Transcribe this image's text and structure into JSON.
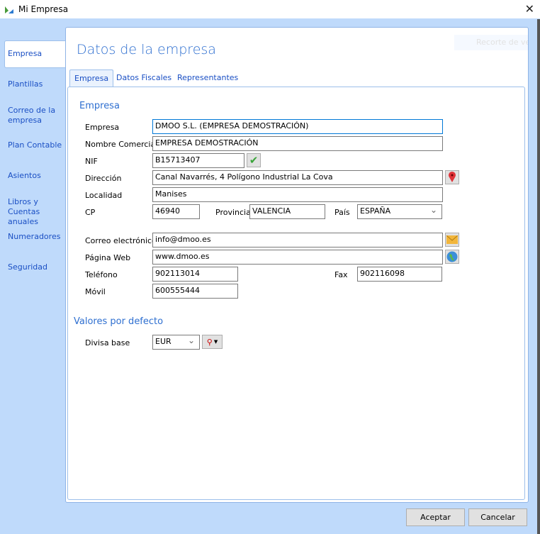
{
  "window": {
    "title": "Mi Empresa"
  },
  "sidebar": {
    "items": [
      {
        "label": "Empresa"
      },
      {
        "label": "Plantillas"
      },
      {
        "label": "Correo de la empresa"
      },
      {
        "label": "Plan Contable"
      },
      {
        "label": "Asientos"
      },
      {
        "label": "Libros y Cuentas anuales"
      },
      {
        "label": "Numeradores"
      },
      {
        "label": "Seguridad"
      }
    ]
  },
  "header": {
    "title": "Datos de la empresa",
    "ghost": "Recorte de ventana"
  },
  "tabs": [
    {
      "label": "Empresa"
    },
    {
      "label": "Datos Fiscales"
    },
    {
      "label": "Representantes"
    }
  ],
  "form": {
    "section": "Empresa",
    "empresa": {
      "label": "Empresa",
      "value": "DMOO S.L. (EMPRESA DEMOSTRACIÓN)"
    },
    "nombre_comercial": {
      "label": "Nombre Comercial",
      "value": "EMPRESA DEMOSTRACIÓN"
    },
    "nif": {
      "label": "NIF",
      "value": "B15713407"
    },
    "direccion": {
      "label": "Dirección",
      "value": "Canal Navarrés, 4 Polígono Industrial La Cova"
    },
    "localidad": {
      "label": "Localidad",
      "value": "Manises"
    },
    "cp": {
      "label": "CP",
      "value": "46940"
    },
    "provincia": {
      "label": "Provincia",
      "value": "VALENCIA"
    },
    "pais": {
      "label": "País",
      "value": "ESPAÑA"
    },
    "correo": {
      "label": "Correo electrónico",
      "value": "info@dmoo.es"
    },
    "web": {
      "label": "Página Web",
      "value": "www.dmoo.es"
    },
    "telefono": {
      "label": "Teléfono",
      "value": "902113014"
    },
    "fax": {
      "label": "Fax",
      "value": "902116098"
    },
    "movil": {
      "label": "Móvil",
      "value": "600555444"
    },
    "defaults_section": "Valores por defecto",
    "divisa": {
      "label": "Divisa base",
      "value": "EUR"
    }
  },
  "footer": {
    "accept": "Aceptar",
    "cancel": "Cancelar"
  }
}
